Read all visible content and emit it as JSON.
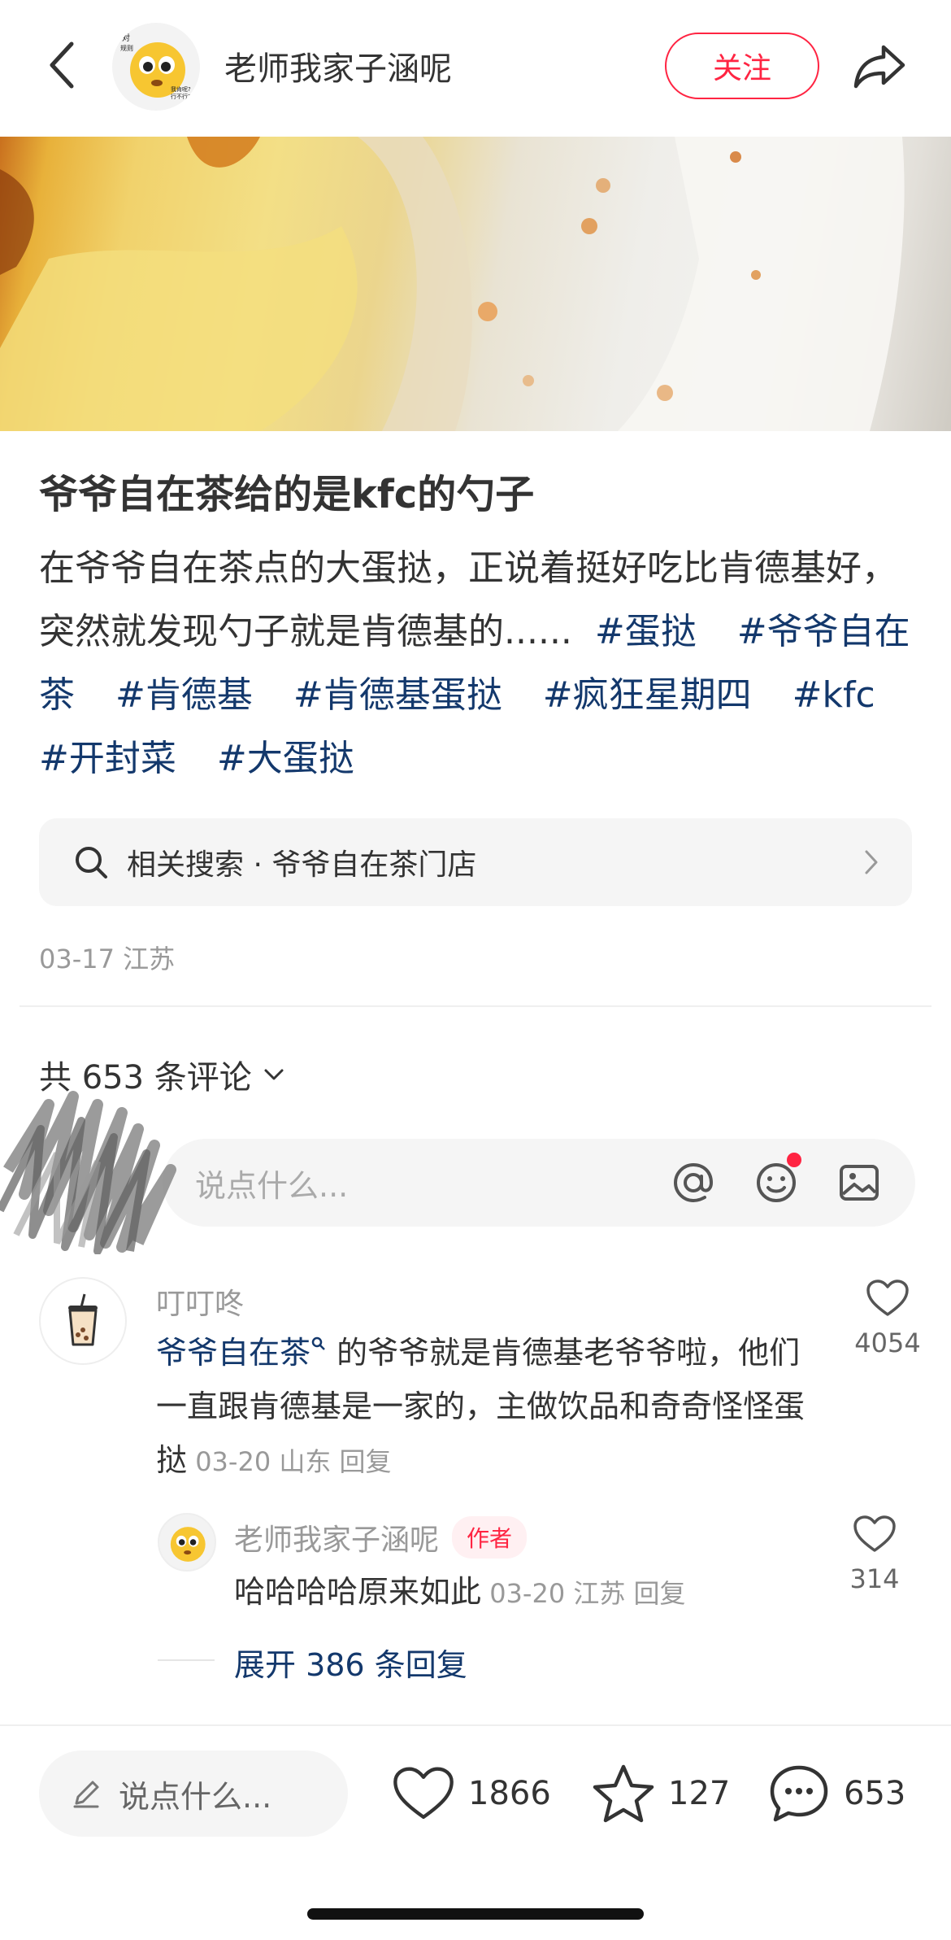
{
  "header": {
    "author_name": "老师我家子涵呢",
    "follow_label": "关注",
    "avatar_text_left": "对",
    "avatar_text_left2": "规则",
    "avatar_text_right": "我肯呢？",
    "avatar_text_right2": "行不行？"
  },
  "post": {
    "title": "爷爷自在茶给的是kfc的勺子",
    "description": "在爷爷自在茶点的大蛋挞，正说着挺好吃比肯德基好，突然就发现勺子就是肯德基的......",
    "tags": [
      "#蛋挞",
      "#爷爷自在茶",
      "#肯德基",
      "#肯德基蛋挞",
      "#疯狂星期四",
      "#kfc",
      "#开封菜",
      "#大蛋挞"
    ],
    "related_search": "相关搜索 · 爷爷自在茶门店",
    "date_location": "03-17 江苏"
  },
  "comments_section": {
    "count_label": "共 653 条评论",
    "input_placeholder": "说点什么..."
  },
  "comment": {
    "user": "叮叮咚",
    "link_text": "爷爷自在茶",
    "text": " 的爷爷就是肯德基老爷爷啦，他们一直跟肯德基是一家的，主做饮品和奇奇怪怪蛋挞",
    "meta": " 03-20 山东 回复",
    "likes": "4054"
  },
  "reply": {
    "user": "老师我家子涵呢",
    "badge": "作者",
    "text": "哈哈哈哈原来如此",
    "meta": " 03-20 江苏 回复",
    "likes": "314"
  },
  "expand_label": "展开 386 条回复",
  "bottom_bar": {
    "input_placeholder": "说点什么...",
    "likes": "1866",
    "favorites": "127",
    "comments": "653"
  },
  "colors": {
    "accent": "#ff2442",
    "link": "#13386c",
    "muted": "#999999"
  }
}
